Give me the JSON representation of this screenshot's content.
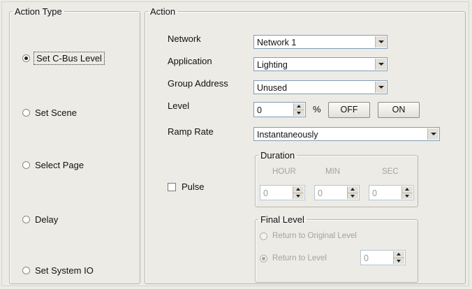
{
  "action_type": {
    "legend": "Action Type",
    "options": [
      {
        "label": "Set C-Bus Level",
        "selected": true
      },
      {
        "label": "Set Scene",
        "selected": false
      },
      {
        "label": "Select Page",
        "selected": false
      },
      {
        "label": "Delay",
        "selected": false
      },
      {
        "label": "Set System IO",
        "selected": false
      }
    ]
  },
  "action": {
    "legend": "Action",
    "network": {
      "label": "Network",
      "value": "Network 1"
    },
    "application": {
      "label": "Application",
      "value": "Lighting"
    },
    "group_address": {
      "label": "Group Address",
      "value": "Unused"
    },
    "level": {
      "label": "Level",
      "value": "0",
      "unit": "%",
      "off_label": "OFF",
      "on_label": "ON"
    },
    "ramp_rate": {
      "label": "Ramp Rate",
      "value": "Instantaneously"
    },
    "pulse": {
      "label": "Pulse",
      "checked": false
    },
    "duration": {
      "legend": "Duration",
      "hour_label": "HOUR",
      "hour_value": "0",
      "min_label": "MIN",
      "min_value": "0",
      "sec_label": "SEC",
      "sec_value": "0"
    },
    "final_level": {
      "legend": "Final Level",
      "return_original_label": "Return to Original Level",
      "return_level_label": "Return to Level",
      "return_level_value": "0",
      "selected": "return_level"
    }
  },
  "colors": {
    "background": "#ecebe6",
    "border": "#b9b7ad",
    "field_border": "#7f9db9",
    "disabled_text": "#a4a39d"
  },
  "icons": [
    "radio-button",
    "checkbox",
    "dropdown-arrow-icon",
    "spin-up-icon",
    "spin-down-icon"
  ]
}
